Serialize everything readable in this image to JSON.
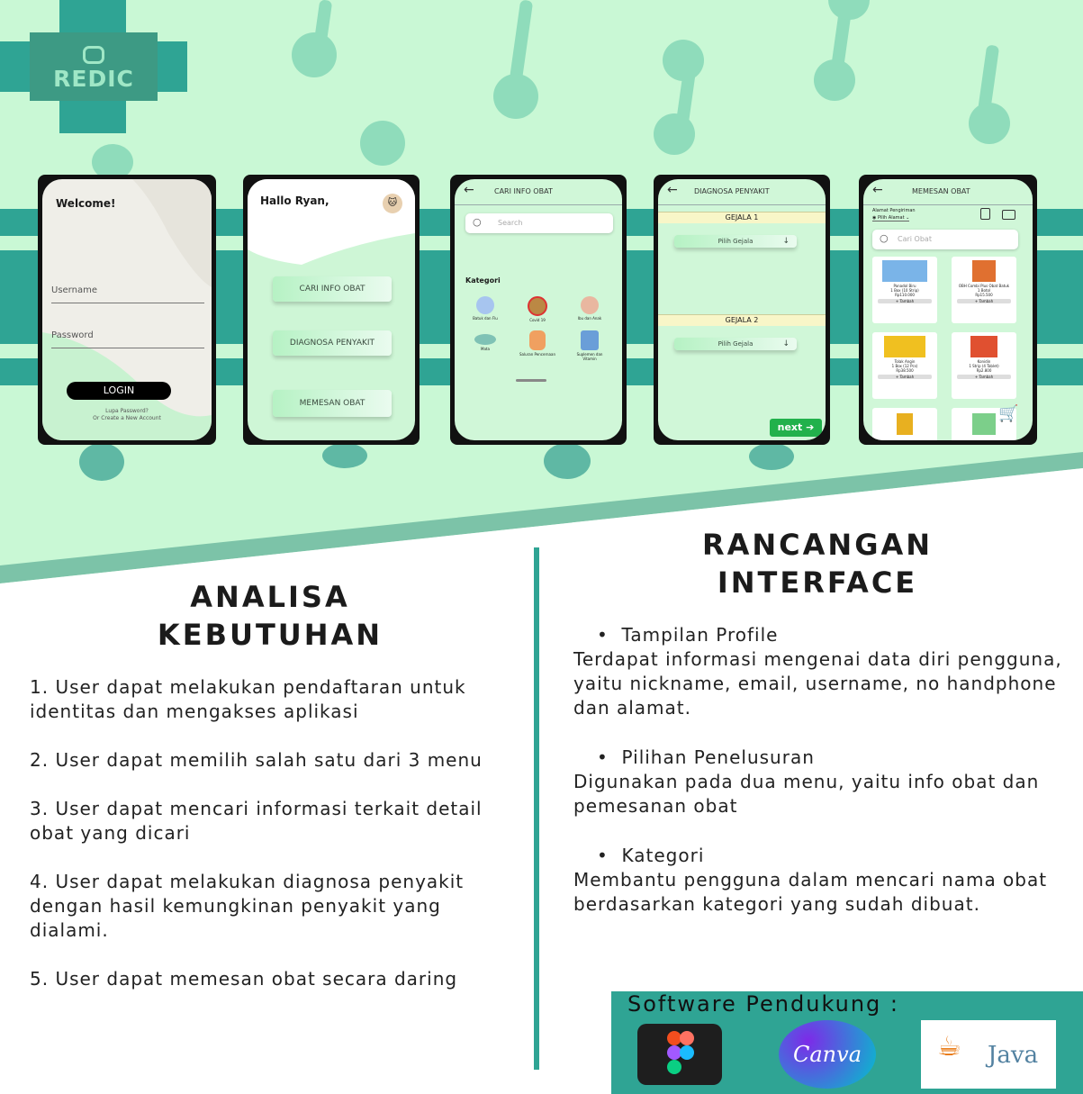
{
  "brand": {
    "name": "REDIC"
  },
  "colors": {
    "teal": "#2fa494",
    "mint": "#c9f8d5",
    "pin": "#8fdcbb",
    "dark": "#111111"
  },
  "screens": {
    "login": {
      "title": "Welcome!",
      "username": "Username",
      "password": "Password",
      "button": "LOGIN",
      "forgot": "Lupa Password?",
      "create": "Or Create a New Account"
    },
    "home": {
      "greeting": "Hallo Ryan,",
      "btn1": "CARI INFO OBAT",
      "btn2": "DIAGNOSA PENYAKIT",
      "btn3": "MEMESAN OBAT"
    },
    "info": {
      "title": "CARI INFO OBAT",
      "search": "Search",
      "kategori": "Kategori",
      "cats": [
        "Batuk dan Flu",
        "Covid 19",
        "Ibu dan Anak",
        "Mata",
        "Saluran Pencernaan",
        "Suplemen dan Vitamin"
      ]
    },
    "diag": {
      "title": "DIAGNOSA PENYAKIT",
      "g1": "GEJALA 1",
      "g2": "GEJALA 2",
      "pilih": "Pilih Gejala",
      "next": "next"
    },
    "order": {
      "title": "MEMESAN OBAT",
      "alamat": "Alamat Pengiriman",
      "pilih_alamat": "Pilih Alamat",
      "search": "Cari Obat",
      "products": [
        {
          "name": "Panadol Biru",
          "qty": "1 Box (10 Strip)",
          "price": "Rp110.000",
          "btn": "+ Tambah"
        },
        {
          "name": "OBH Combi Plus Obat Batuk",
          "qty": "1 Botol",
          "price": "Rp15.500",
          "btn": "+ Tambah"
        },
        {
          "name": "Tolak Angin",
          "qty": "1 Box (12 Pcs)",
          "price": "Rp38.500",
          "btn": "+ Tambah"
        },
        {
          "name": "Konidin",
          "qty": "1 Strip (4 Tablet)",
          "price": "Rp2.800",
          "btn": "+ Tambah"
        }
      ]
    }
  },
  "left": {
    "title_line1": "ANALISA",
    "title_line2": "KEBUTUHAN",
    "items": [
      "1. User dapat melakukan pendaftaran untuk identitas dan mengakses aplikasi",
      "2. User dapat memilih salah satu dari 3 menu",
      "3. User dapat mencari informasi terkait detail obat yang dicari",
      "4. User dapat melakukan diagnosa penyakit dengan hasil kemungkinan penyakit yang dialami.",
      "5. User dapat memesan obat secara daring"
    ]
  },
  "right": {
    "title_line1": "RANCANGAN",
    "title_line2": "INTERFACE",
    "sections": [
      {
        "bullet": "Tampilan Profile",
        "text": "Terdapat informasi mengenai data diri pengguna, yaitu nickname, email, username, no handphone dan alamat."
      },
      {
        "bullet": "Pilihan Penelusuran",
        "text": "Digunakan pada dua menu, yaitu info obat dan pemesanan obat"
      },
      {
        "bullet": "Kategori",
        "text": "Membantu pengguna dalam mencari nama obat berdasarkan kategori yang sudah dibuat."
      }
    ]
  },
  "software": {
    "title": "Software Pendukung :",
    "tools": [
      "Canva",
      "Java"
    ]
  }
}
